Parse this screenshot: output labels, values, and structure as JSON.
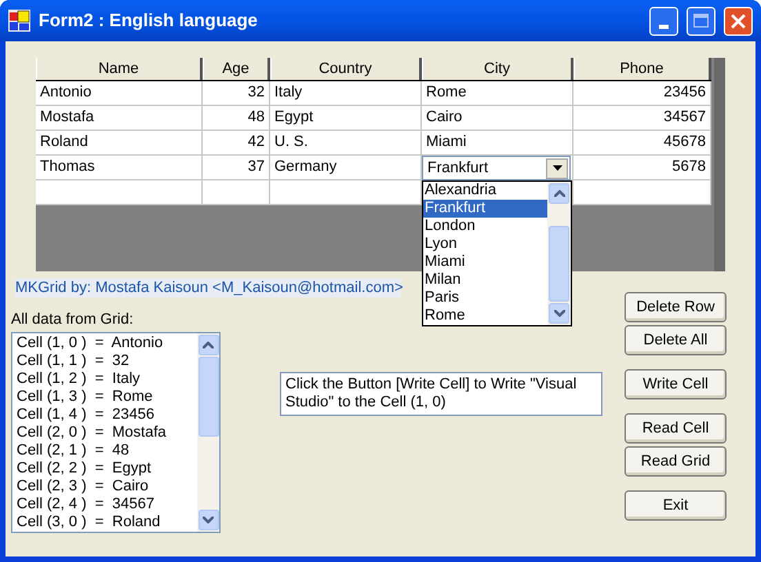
{
  "window": {
    "title": "Form2 : English language"
  },
  "grid": {
    "columns": [
      {
        "label": "Name",
        "kind": "text"
      },
      {
        "label": "Age",
        "kind": "number"
      },
      {
        "label": "Country",
        "kind": "text"
      },
      {
        "label": "City",
        "kind": "text"
      },
      {
        "label": "Phone",
        "kind": "number"
      }
    ],
    "rows": [
      {
        "cells": [
          "Antonio",
          "32",
          "Italy",
          "Rome",
          "23456"
        ],
        "editing": false
      },
      {
        "cells": [
          "Mostafa",
          "48",
          "Egypt",
          "Cairo",
          "34567"
        ],
        "editing": false
      },
      {
        "cells": [
          "Roland",
          "42",
          "U. S.",
          "Miami",
          "45678"
        ],
        "editing": false
      },
      {
        "cells": [
          "Thomas",
          "37",
          "Germany",
          "Frankfurt",
          "5678"
        ],
        "editing": true
      }
    ]
  },
  "city_dropdown": {
    "options": [
      {
        "label": "Alexandria",
        "selected": false
      },
      {
        "label": "Frankfurt",
        "selected": true
      },
      {
        "label": "London",
        "selected": false
      },
      {
        "label": "Lyon",
        "selected": false
      },
      {
        "label": "Miami",
        "selected": false
      },
      {
        "label": "Milan",
        "selected": false
      },
      {
        "label": "Paris",
        "selected": false
      },
      {
        "label": "Rome",
        "selected": false
      }
    ]
  },
  "credit": "MKGrid  by: Mostafa Kaisoun  <M_Kaisoun@hotmail.com>",
  "list_label": "All data from Grid:",
  "list_items": [
    "Cell (1, 0 )  =  Antonio",
    "Cell (1, 1 )  =  32",
    "Cell (1, 2 )  =  Italy",
    "Cell (1, 3 )  =  Rome",
    "Cell (1, 4 )  =  23456",
    "Cell (2, 0 )  =  Mostafa",
    "Cell (2, 1 )  =  48",
    "Cell (2, 2 )  =  Egypt",
    "Cell (2, 3 )  =  Cairo",
    "Cell (2, 4 )  =  34567",
    "Cell (3, 0 )  =  Roland"
  ],
  "message_box": {
    "value": "Click the Button [Write Cell] to Write \"Visual Studio\" to the Cell (1, 0)"
  },
  "button_groups": [
    [
      "Delete Row",
      "Delete All"
    ],
    [
      "Write Cell"
    ],
    [
      "Read Cell",
      "Read Grid"
    ],
    [
      "Exit"
    ]
  ]
}
